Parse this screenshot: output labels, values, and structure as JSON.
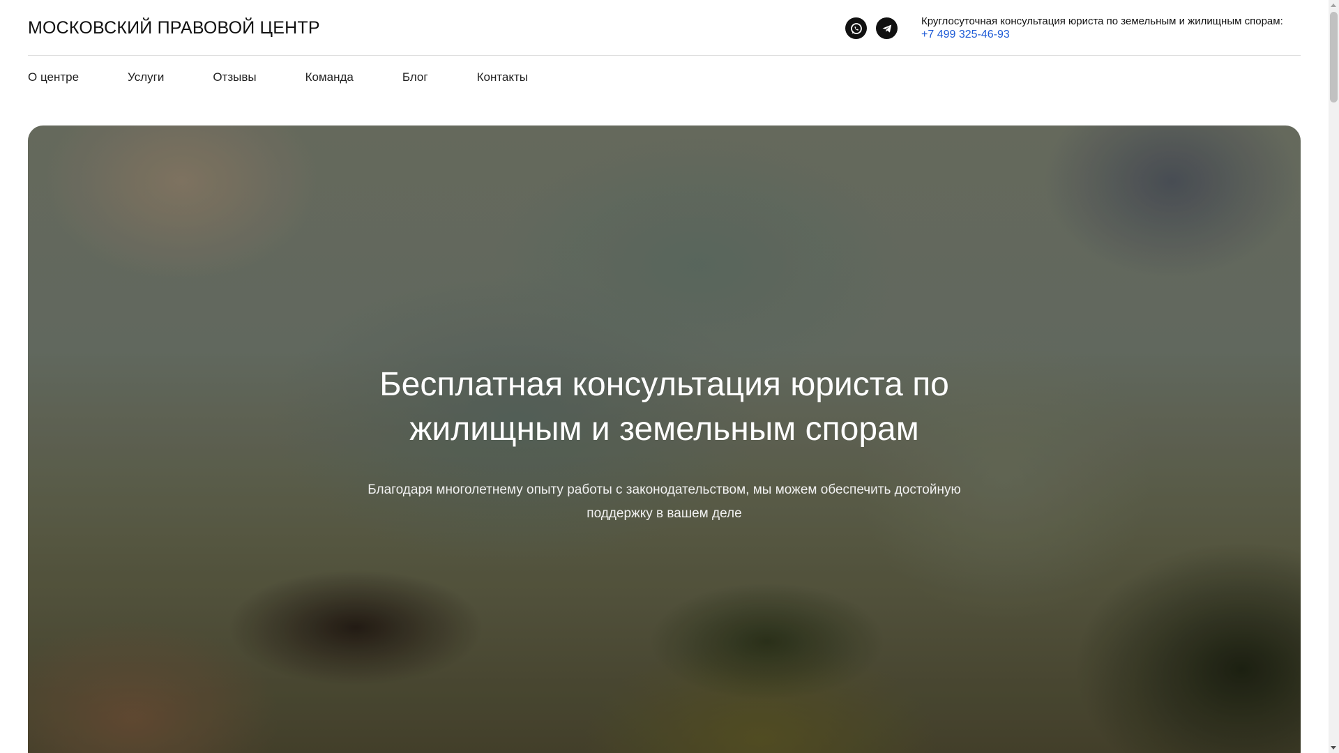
{
  "header": {
    "logo": "МОСКОВСКИЙ ПРАВОВОЙ ЦЕНТР",
    "social": [
      {
        "icon": "whatsapp-icon"
      },
      {
        "icon": "telegram-icon"
      }
    ],
    "contact_text": "Круглосуточная консультация юриста по земельным и жилищным спорам:",
    "phone": "+7 499 325-46-93"
  },
  "nav": {
    "items": [
      "О центре",
      "Услуги",
      "Отзывы",
      "Команда",
      "Блог",
      "Контакты"
    ]
  },
  "hero": {
    "title": "Бесплатная консультация юриста по жилищным и земельным спорам",
    "subtitle": "Благодаря многолетнему опыту работы с законодательством, мы можем обеспечить достойную поддержку в вашем деле"
  },
  "colors": {
    "phone": "#1e5bd6",
    "text": "#111111",
    "hero_text": "#ffffff"
  }
}
